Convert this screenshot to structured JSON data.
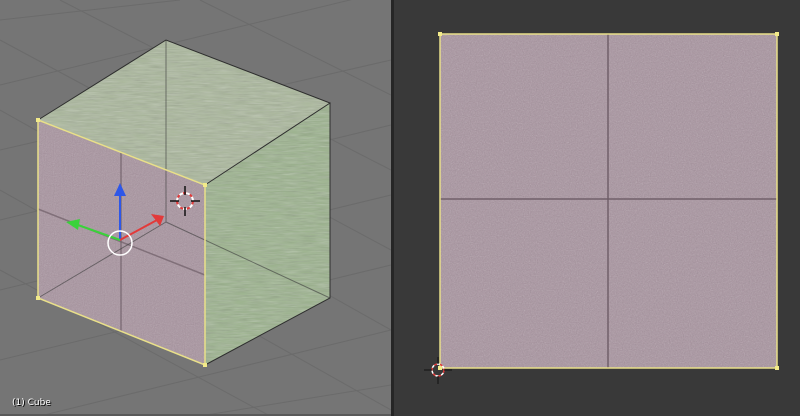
{
  "viewport_3d": {
    "object_label": "(1) Cube"
  },
  "colors": {
    "viewport_bg": "#757575",
    "uv_bg": "#393939",
    "grid_line": "#6a6a6a",
    "selection_edge": "#e9e08a",
    "face_front": "#a8939f",
    "face_top": "#a9b79a",
    "face_side": "#9ab28b",
    "axis_x": "#e23a3a",
    "axis_y": "#3ad23a",
    "axis_z": "#2e57e8"
  },
  "icons": [
    "transform-manipulator-icon",
    "3d-cursor-icon",
    "uv-cursor-icon"
  ]
}
